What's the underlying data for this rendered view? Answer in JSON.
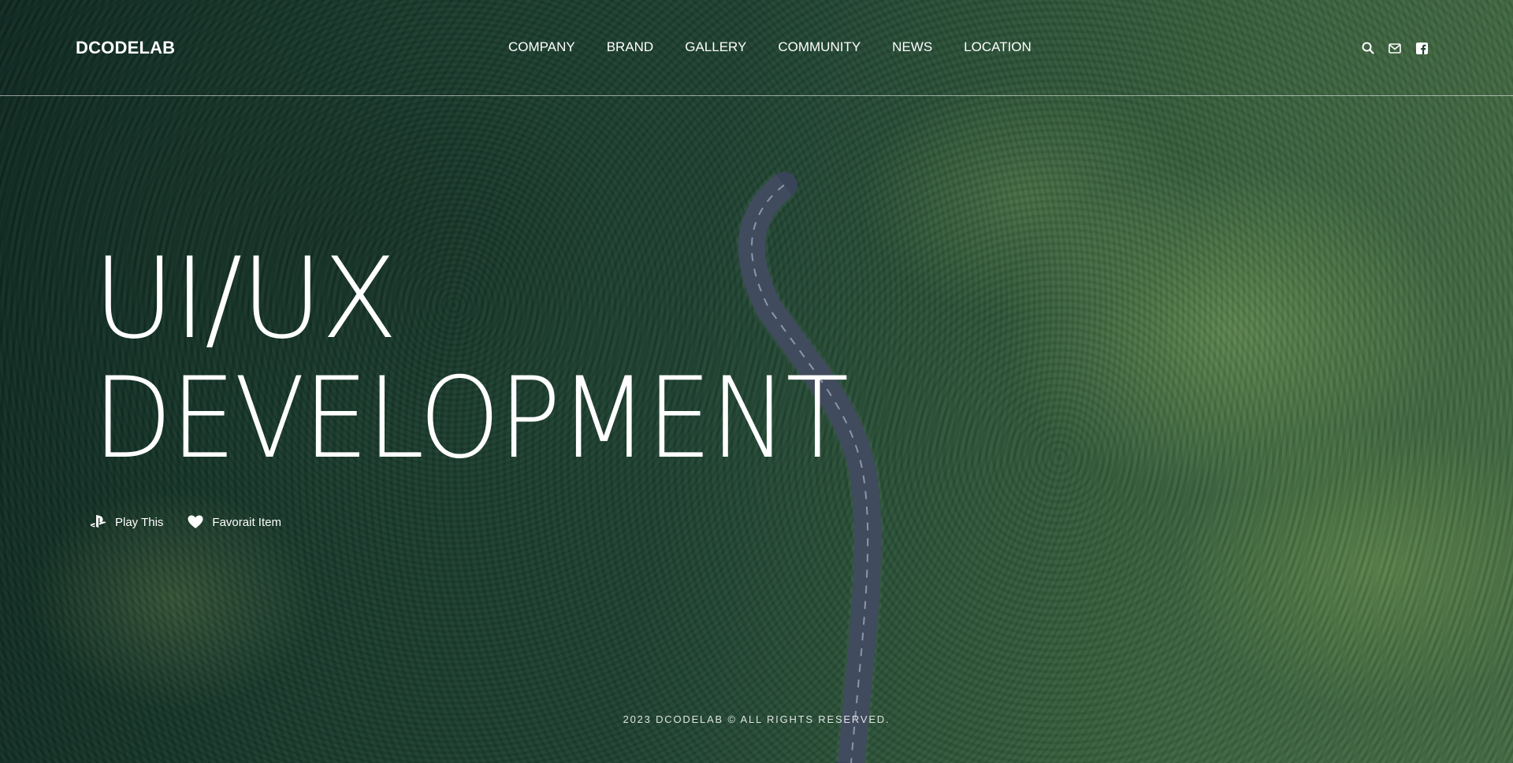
{
  "brand": {
    "logo_text": "DCODELAB"
  },
  "nav": {
    "items": [
      {
        "label": "COMPANY"
      },
      {
        "label": "BRAND"
      },
      {
        "label": "GALLERY"
      },
      {
        "label": "COMMUNITY"
      },
      {
        "label": "NEWS"
      },
      {
        "label": "LOCATION"
      }
    ],
    "icons": [
      "search-icon",
      "mail-icon",
      "facebook-icon"
    ]
  },
  "hero": {
    "title_line1": "UI/UX",
    "title_line2": "DEVELOPMENT"
  },
  "actions": [
    {
      "label": "Play This",
      "icon": "playstation-icon"
    },
    {
      "label": "Favorait Item",
      "icon": "heart-icon"
    }
  ],
  "footer": {
    "text": "2023 DCODELAB © ALL RIGHTS RESERVED."
  },
  "colors": {
    "text": "#ffffff",
    "background_accent": "#1f4232"
  }
}
